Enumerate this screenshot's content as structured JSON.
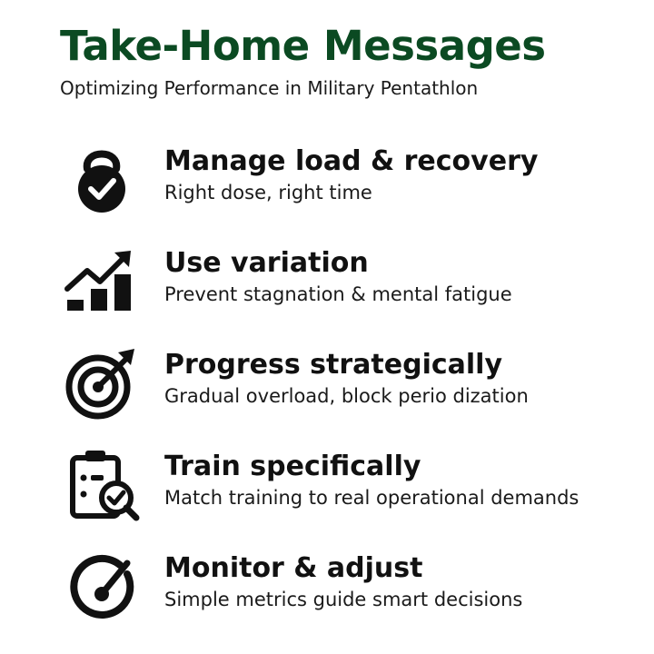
{
  "header": {
    "title": "Take-Home Messages",
    "subtitle": "Optimizing Performance in Military Pentathlon"
  },
  "colors": {
    "title": "#0b4a22",
    "text": "#111111",
    "icon": "#111111"
  },
  "messages": [
    {
      "icon": "kettlebell-check-icon",
      "title": "Manage load & recovery",
      "description": "Right dose, right time"
    },
    {
      "icon": "rising-bars-arrow-icon",
      "title": "Use variation",
      "description": "Prevent stagnation & mental fatigue"
    },
    {
      "icon": "target-arrow-icon",
      "title": "Progress strategically",
      "description": "Gradual overload, block perio dization"
    },
    {
      "icon": "clipboard-check-icon",
      "title": "Train specifically",
      "description": "Match training to real operational demands"
    },
    {
      "icon": "gauge-icon",
      "title": "Monitor & adjust",
      "description": "Simple metrics guide smart decisions"
    }
  ]
}
